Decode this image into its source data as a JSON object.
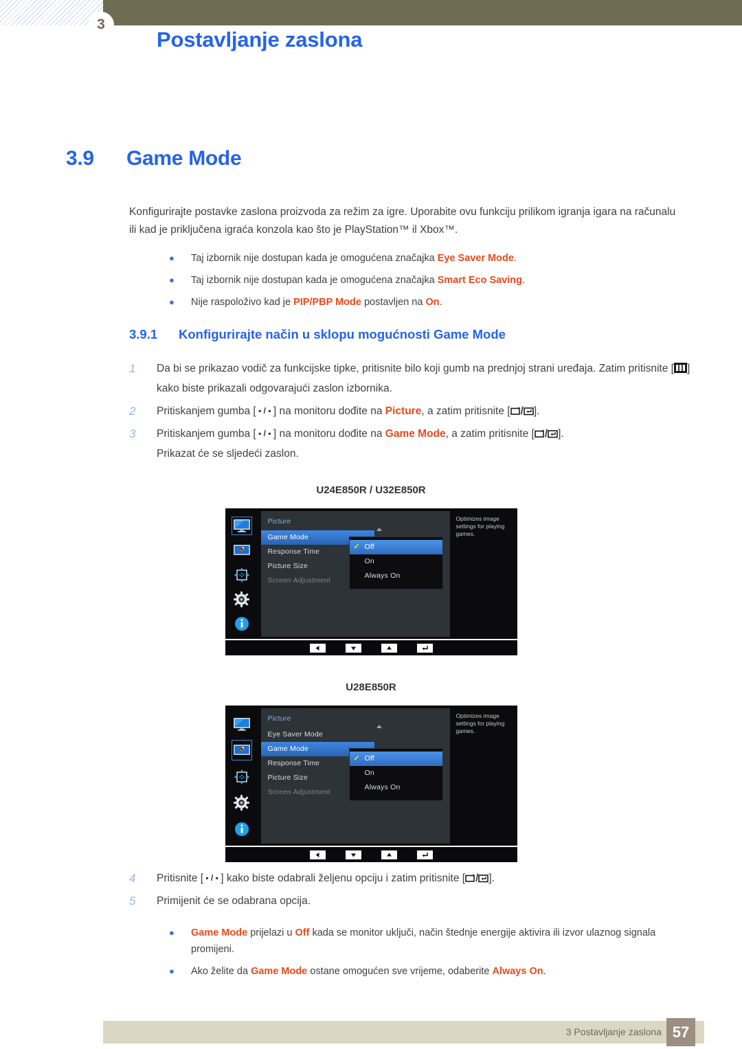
{
  "header": {
    "badge": "3",
    "title": "Postavljanje zaslona"
  },
  "section": {
    "number": "3.9",
    "title": "Game Mode"
  },
  "intro": "Konfigurirajte postavke zaslona proizvoda za režim za igre. Uporabite ovu funkciju prilikom igranja igara na računalu ili kad je priključena igraća konzola kao što je PlayStation™ il Xbox™.",
  "notes_top": [
    {
      "pre": "Taj izbornik nije dostupan kada je omogućena značajka ",
      "hl": "Eye Saver Mode",
      "post": "."
    },
    {
      "pre": "Taj izbornik nije dostupan kada je omogućena značajka ",
      "hl": "Smart Eco Saving",
      "post": "."
    },
    {
      "pre": "Nije raspoloživo kad je ",
      "hl": "PIP/PBP Mode",
      "post": " postavljen na ",
      "hl2": "On",
      "post2": "."
    }
  ],
  "subsection": {
    "number": "3.9.1",
    "title": "Konfigurirajte način u sklopu mogućnosti Game Mode"
  },
  "steps": {
    "s1": {
      "num": "1",
      "a": "Da bi se prikazao vodič za funkcijske tipke, pritisnite bilo koji gumb na prednjoj strani uređaja. Zatim pritisnite [",
      "b": "] kako biste prikazali odgovarajući zaslon izbornika."
    },
    "s2": {
      "num": "2",
      "a": "Pritiskanjem gumba [",
      "b": "] na monitoru dođite na ",
      "hl": "Picture",
      "c": ", a zatim pritisnite [",
      "d": "]."
    },
    "s3": {
      "num": "3",
      "a": "Pritiskanjem gumba [",
      "b": "] na monitoru dođite na ",
      "hl": "Game Mode",
      "c": ", a zatim pritisnite [",
      "d": "].",
      "note": "Prikazat će se sljedeći zaslon."
    },
    "s4": {
      "num": "4",
      "a": "Pritisnite [",
      "b": "] kako biste odabrali željenu opciju i zatim pritisnite [",
      "c": "]."
    },
    "s5": {
      "num": "5",
      "a": "Primijenit će se odabrana opcija."
    }
  },
  "figures": [
    {
      "caption": "U24E850R / U32E850R",
      "osd_title": "Picture",
      "selected_side_icon": 0,
      "menu": [
        {
          "label": "Game Mode",
          "state": "active"
        },
        {
          "label": "Response Time",
          "state": "normal"
        },
        {
          "label": "Picture Size",
          "state": "normal"
        },
        {
          "label": "Screen Adjustment",
          "state": "dim"
        }
      ],
      "options": [
        {
          "label": "Off",
          "selected": true
        },
        {
          "label": "On",
          "selected": false
        },
        {
          "label": "Always On",
          "selected": false
        }
      ],
      "help": "Optimizes image settings for playing games."
    },
    {
      "caption": "U28E850R",
      "osd_title": "Picture",
      "selected_side_icon": 1,
      "menu": [
        {
          "label": "Eye Saver Mode",
          "state": "normal"
        },
        {
          "label": "Game Mode",
          "state": "active"
        },
        {
          "label": "Response Time",
          "state": "normal"
        },
        {
          "label": "Picture Size",
          "state": "normal"
        },
        {
          "label": "Screen Adjustment",
          "state": "dim"
        }
      ],
      "options": [
        {
          "label": "Off",
          "selected": true
        },
        {
          "label": "On",
          "selected": false
        },
        {
          "label": "Always On",
          "selected": false
        }
      ],
      "help": "Optimizes image settings for playing games."
    }
  ],
  "side_icons": [
    "monitor-icon",
    "picture-color-icon",
    "move-arrows-icon",
    "gear-icon",
    "info-icon"
  ],
  "foot_buttons": [
    "left-arrow-icon",
    "down-arrow-icon",
    "up-arrow-icon",
    "enter-arrow-icon"
  ],
  "notes_bottom": [
    {
      "hl": "Game Mode",
      "mid": " prijelazi u ",
      "hl2": "Off",
      "post": " kada se monitor uključi, način štednje energije aktivira ili izvor ulaznog signala promijeni."
    },
    {
      "pre": "Ako želite da ",
      "hl": "Game Mode",
      "mid": " ostane omogućen sve vrijeme, odaberite ",
      "hl2": "Always On",
      "post": "."
    }
  ],
  "footer": {
    "text": "3 Postavljanje zaslona",
    "page": "57"
  },
  "colors": {
    "accent_blue": "#2563eb",
    "highlight_orange": "#e8491b",
    "header_olive": "#6f6b52",
    "footer_beige": "#dcd7c4",
    "page_box": "#9c8e80"
  }
}
